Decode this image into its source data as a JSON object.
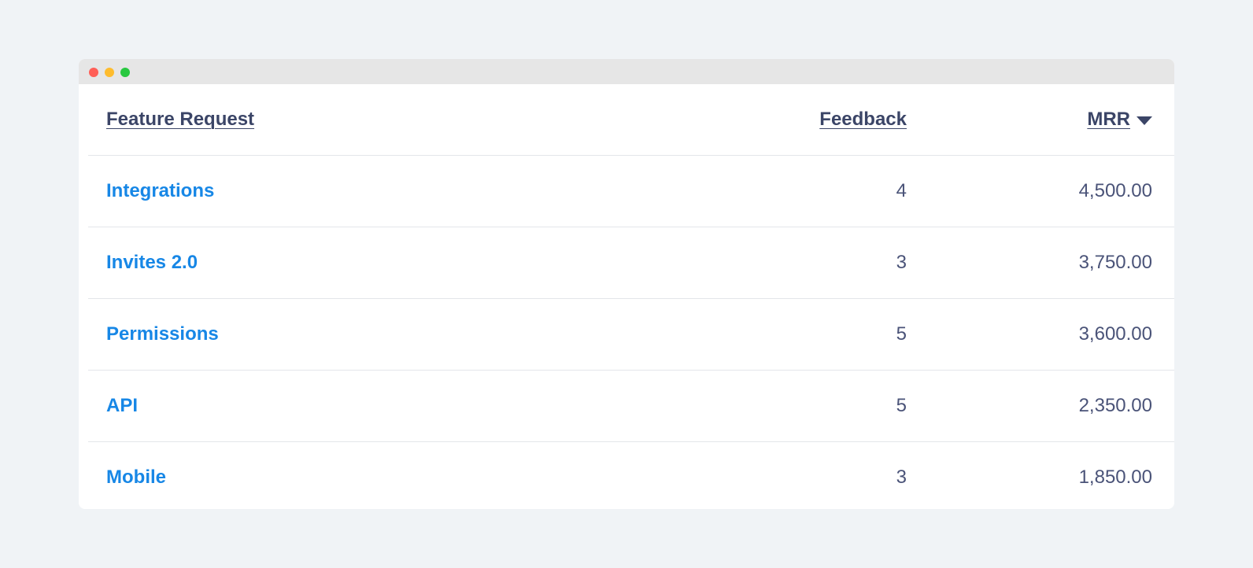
{
  "window": {
    "controls": [
      "close",
      "minimize",
      "maximize"
    ]
  },
  "table": {
    "headers": {
      "name": "Feature Request",
      "feedback": "Feedback",
      "mrr": "MRR",
      "sort_icon": "caret-down-icon"
    },
    "rows": [
      {
        "name": "Integrations",
        "feedback": "4",
        "mrr": "4,500.00"
      },
      {
        "name": "Invites 2.0",
        "feedback": "3",
        "mrr": "3,750.00"
      },
      {
        "name": "Permissions",
        "feedback": "5",
        "mrr": "3,600.00"
      },
      {
        "name": "API",
        "feedback": "5",
        "mrr": "2,350.00"
      },
      {
        "name": "Mobile",
        "feedback": "3",
        "mrr": "1,850.00"
      }
    ]
  },
  "colors": {
    "background": "#f0f3f6",
    "titlebar": "#e6e6e6",
    "header_text": "#3b4567",
    "link": "#1787e6",
    "number_text": "#4a5378",
    "close_dot": "#ff5f57",
    "minimize_dot": "#febc2e",
    "maximize_dot": "#28c840"
  }
}
